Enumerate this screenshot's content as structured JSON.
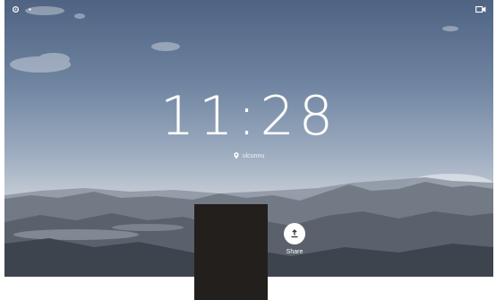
{
  "clock": {
    "time": "11:28"
  },
  "location": {
    "text": "ulcunnu",
    "icon": "location-pin-icon"
  },
  "status_bar": {
    "left_icons": [
      "settings-icon",
      "dot-icon"
    ],
    "right_icon": "camera-icon"
  },
  "actions": {
    "share": {
      "label": "Share",
      "icon": "share-icon"
    }
  },
  "colors": {
    "sky_top": "#4f6382",
    "sky_horizon": "#c1c9d3",
    "mountains": "#575e68",
    "overlay": "#231f1c",
    "text": "#ffffff"
  }
}
